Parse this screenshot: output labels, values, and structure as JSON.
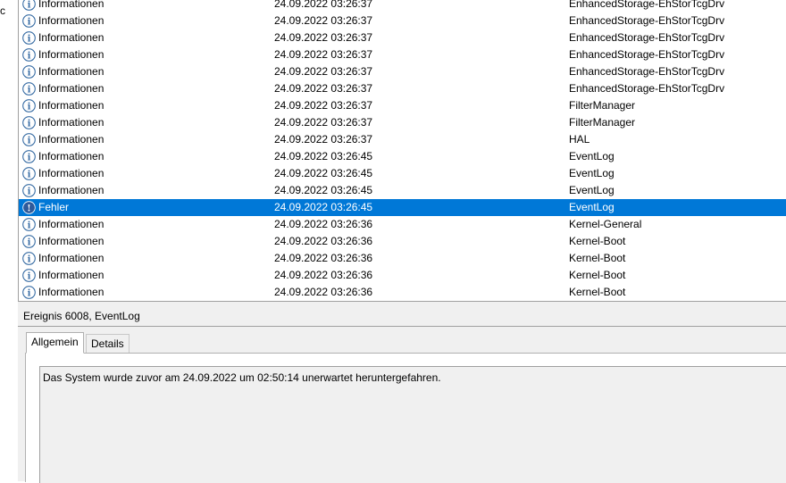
{
  "left_pane_stub": "rc",
  "columns": {
    "level": "",
    "date": "",
    "source": ""
  },
  "event_rows": [
    {
      "level": "Informationen",
      "date": "24.09.2022 03:26:37",
      "source": "EnhancedStorage-EhStorTcgDrv",
      "type": "info"
    },
    {
      "level": "Informationen",
      "date": "24.09.2022 03:26:37",
      "source": "EnhancedStorage-EhStorTcgDrv",
      "type": "info"
    },
    {
      "level": "Informationen",
      "date": "24.09.2022 03:26:37",
      "source": "EnhancedStorage-EhStorTcgDrv",
      "type": "info"
    },
    {
      "level": "Informationen",
      "date": "24.09.2022 03:26:37",
      "source": "EnhancedStorage-EhStorTcgDrv",
      "type": "info"
    },
    {
      "level": "Informationen",
      "date": "24.09.2022 03:26:37",
      "source": "EnhancedStorage-EhStorTcgDrv",
      "type": "info"
    },
    {
      "level": "Informationen",
      "date": "24.09.2022 03:26:37",
      "source": "EnhancedStorage-EhStorTcgDrv",
      "type": "info"
    },
    {
      "level": "Informationen",
      "date": "24.09.2022 03:26:37",
      "source": "FilterManager",
      "type": "info"
    },
    {
      "level": "Informationen",
      "date": "24.09.2022 03:26:37",
      "source": "FilterManager",
      "type": "info"
    },
    {
      "level": "Informationen",
      "date": "24.09.2022 03:26:37",
      "source": "HAL",
      "type": "info"
    },
    {
      "level": "Informationen",
      "date": "24.09.2022 03:26:45",
      "source": "EventLog",
      "type": "info"
    },
    {
      "level": "Informationen",
      "date": "24.09.2022 03:26:45",
      "source": "EventLog",
      "type": "info"
    },
    {
      "level": "Informationen",
      "date": "24.09.2022 03:26:45",
      "source": "EventLog",
      "type": "info"
    },
    {
      "level": "Fehler",
      "date": "24.09.2022 03:26:45",
      "source": "EventLog",
      "type": "error",
      "selected": true
    },
    {
      "level": "Informationen",
      "date": "24.09.2022 03:26:36",
      "source": "Kernel-General",
      "type": "info"
    },
    {
      "level": "Informationen",
      "date": "24.09.2022 03:26:36",
      "source": "Kernel-Boot",
      "type": "info"
    },
    {
      "level": "Informationen",
      "date": "24.09.2022 03:26:36",
      "source": "Kernel-Boot",
      "type": "info"
    },
    {
      "level": "Informationen",
      "date": "24.09.2022 03:26:36",
      "source": "Kernel-Boot",
      "type": "info"
    },
    {
      "level": "Informationen",
      "date": "24.09.2022 03:26:36",
      "source": "Kernel-Boot",
      "type": "info"
    }
  ],
  "detail": {
    "header": "Ereignis 6008, EventLog",
    "tabs": [
      "Allgemein",
      "Details"
    ],
    "active_tab": "Allgemein",
    "message": "Das System wurde zuvor am 24.09.2022 um 02:50:14 unerwartet heruntergefahren."
  },
  "colors": {
    "selection": "#0078d7",
    "info_icon": "#3a6ea5",
    "error_icon": "#2f5a9a"
  },
  "icons": {
    "info": "info-icon",
    "error": "error-icon"
  }
}
